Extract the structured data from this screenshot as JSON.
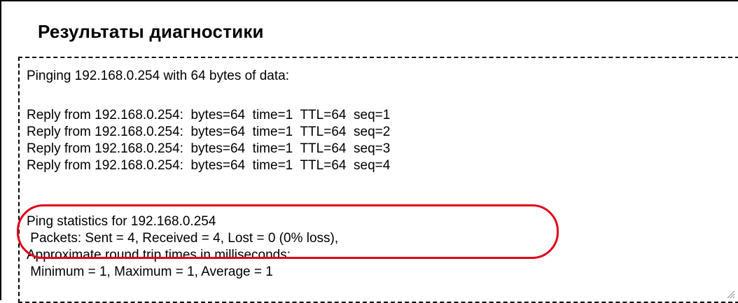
{
  "page": {
    "title": "Результаты диагностики"
  },
  "output": {
    "lines": [
      "Pinging 192.168.0.254 with 64 bytes of data:",
      "",
      "Reply from 192.168.0.254:  bytes=64  time=1  TTL=64  seq=1",
      "Reply from 192.168.0.254:  bytes=64  time=1  TTL=64  seq=2",
      "Reply from 192.168.0.254:  bytes=64  time=1  TTL=64  seq=3",
      "Reply from 192.168.0.254:  bytes=64  time=1  TTL=64  seq=4",
      "",
      "Ping statistics for 192.168.0.254",
      " Packets: Sent = 4, Received = 4, Lost = 0 (0% loss),",
      "Approximate round trip times in milliseconds:",
      " Minimum = 1, Maximum = 1, Average = 1"
    ]
  },
  "annotation": {
    "color": "#e0001a"
  }
}
